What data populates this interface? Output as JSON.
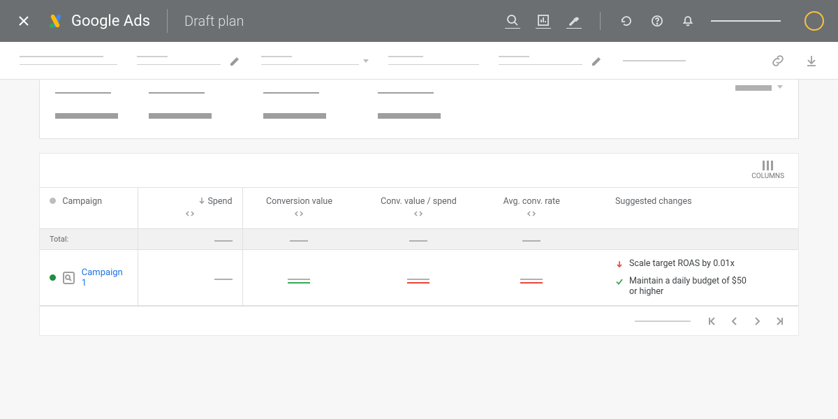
{
  "header": {
    "brand": "Google Ads",
    "page_title": "Draft plan"
  },
  "table": {
    "columns_label": "COLUMNS",
    "headers": {
      "campaign": "Campaign",
      "spend": "Spend",
      "conv_value": "Conversion value",
      "conv_value_spend": "Conv. value / spend",
      "avg_conv_rate": "Avg. conv. rate",
      "suggested": "Suggested changes"
    },
    "total_label": "Total:",
    "rows": [
      {
        "name": "Campaign 1",
        "status": "enabled",
        "suggestions": [
          {
            "type": "down",
            "text": "Scale target ROAS by 0.01x"
          },
          {
            "type": "ok",
            "text": "Maintain a daily budget of $50 or higher"
          }
        ]
      }
    ]
  }
}
